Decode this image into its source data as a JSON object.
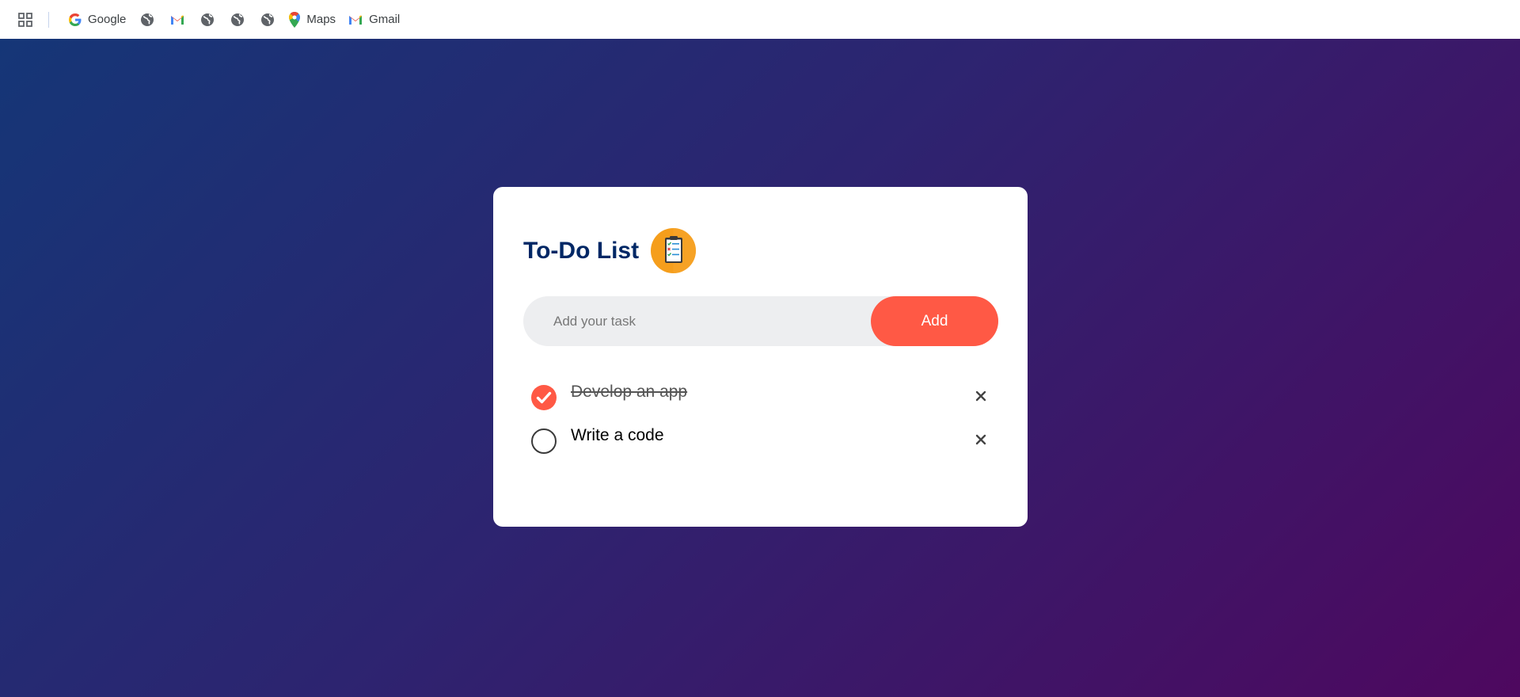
{
  "bookmarks": {
    "items": [
      {
        "type": "labeled",
        "icon": "google-g-icon",
        "label": "Google"
      },
      {
        "type": "icon",
        "icon": "globe-icon"
      },
      {
        "type": "icon",
        "icon": "gmail-icon"
      },
      {
        "type": "icon",
        "icon": "globe-icon"
      },
      {
        "type": "icon",
        "icon": "globe-icon"
      },
      {
        "type": "icon",
        "icon": "globe-icon"
      },
      {
        "type": "labeled",
        "icon": "maps-pin-icon",
        "label": "Maps"
      },
      {
        "type": "labeled",
        "icon": "gmail-icon",
        "label": "Gmail"
      }
    ]
  },
  "app": {
    "title": "To-Do List",
    "title_icon": "clipboard-checklist-icon",
    "input_placeholder": "Add your task",
    "input_value": "",
    "add_label": "Add"
  },
  "tasks": [
    {
      "text": "Develop an app",
      "done": true
    },
    {
      "text": "Write a code",
      "done": false
    }
  ],
  "colors": {
    "accent": "#ff5945",
    "title": "#002765",
    "background_start": "#153677",
    "background_end": "#4e085f"
  }
}
